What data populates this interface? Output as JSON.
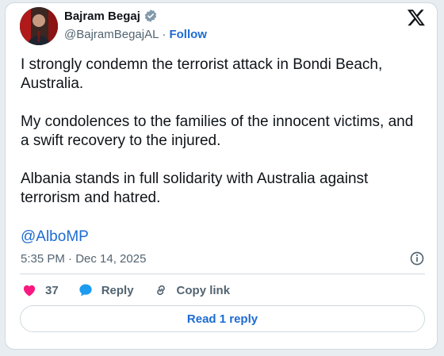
{
  "author": {
    "name": "Bajram Begaj",
    "handle": "@BajramBegajAL",
    "separator": "·",
    "follow_label": "Follow"
  },
  "tweet": {
    "paragraphs": [
      "I strongly condemn the terrorist attack in Bondi Beach, Australia.",
      "My condolences to the families of the innocent victims, and a swift recovery to the injured.",
      "Albania stands in full solidarity with Australia against terrorism and hatred."
    ],
    "mention": "@AlboMP",
    "timestamp": "5:35 PM · Dec 14, 2025"
  },
  "actions": {
    "like_count": "37",
    "reply_label": "Reply",
    "copy_link_label": "Copy link"
  },
  "read_reply_label": "Read 1 reply",
  "colors": {
    "accent": "#1d6bd2",
    "like": "#f91880",
    "verified": "#829aab",
    "text": "#0f1419",
    "muted": "#536471"
  },
  "icons": {
    "logo": "x-logo-icon",
    "verified": "verified-badge-icon",
    "info": "info-icon",
    "like": "heart-icon",
    "reply": "speech-bubble-icon",
    "copy_link": "link-icon"
  }
}
